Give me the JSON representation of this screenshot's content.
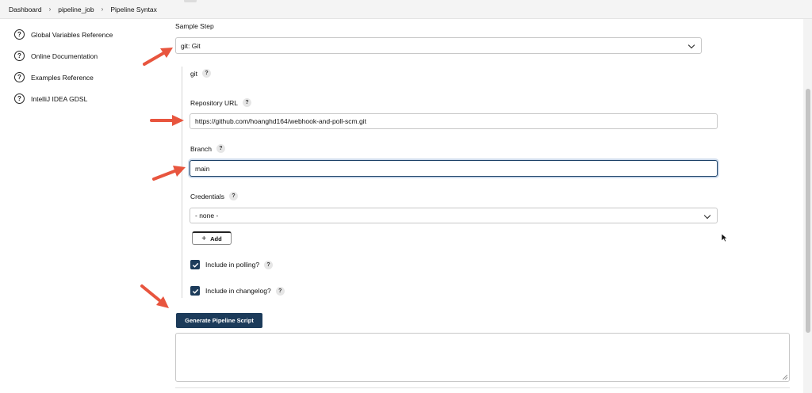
{
  "breadcrumb": [
    "Dashboard",
    "pipeline_job",
    "Pipeline Syntax"
  ],
  "sidebar": {
    "items": [
      {
        "label": "Global Variables Reference",
        "icon": "help-circle-icon"
      },
      {
        "label": "Online Documentation",
        "icon": "help-circle-icon"
      },
      {
        "label": "Examples Reference",
        "icon": "help-circle-icon"
      },
      {
        "label": "IntelliJ IDEA GDSL",
        "icon": "help-circle-icon"
      }
    ]
  },
  "form": {
    "sample_step_label": "Sample Step",
    "sample_step_value": "git: Git",
    "step_name": "git",
    "help_mark": "?",
    "repo_url_label": "Repository URL",
    "repo_url_value": "https://github.com/hoanghd164/webhook-and-poll-scm.git",
    "branch_label": "Branch",
    "branch_value": "main",
    "credentials_label": "Credentials",
    "credentials_value": "- none -",
    "add_label": "Add",
    "polling_label": "Include in polling?",
    "polling_checked": true,
    "changelog_label": "Include in changelog?",
    "changelog_checked": true,
    "generate_label": "Generate Pipeline Script",
    "script_output": ""
  },
  "colors": {
    "primary_button": "#1c3b5a",
    "annotation_arrow": "#e8553e",
    "focus_border": "#1a3f66"
  }
}
